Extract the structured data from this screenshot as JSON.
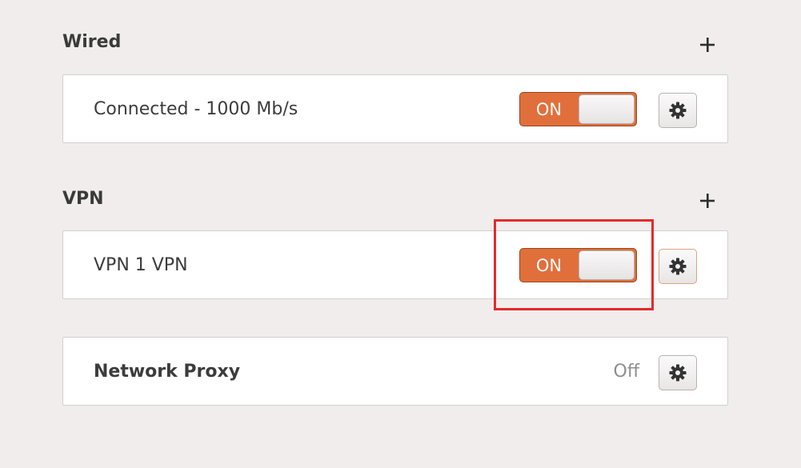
{
  "wired": {
    "title": "Wired",
    "connection_label": "Connected - 1000 Mb/s",
    "toggle_label": "ON",
    "toggle_state": "on"
  },
  "vpn": {
    "title": "VPN",
    "connection_label": "VPN 1 VPN",
    "toggle_label": "ON",
    "toggle_state": "on"
  },
  "proxy": {
    "label": "Network Proxy",
    "status": "Off"
  },
  "colors": {
    "toggle_on": "#e06f3c",
    "highlight": "#e52a2a",
    "background": "#f1eded"
  },
  "icons": {
    "add": "plus-icon",
    "settings": "gear-icon"
  }
}
